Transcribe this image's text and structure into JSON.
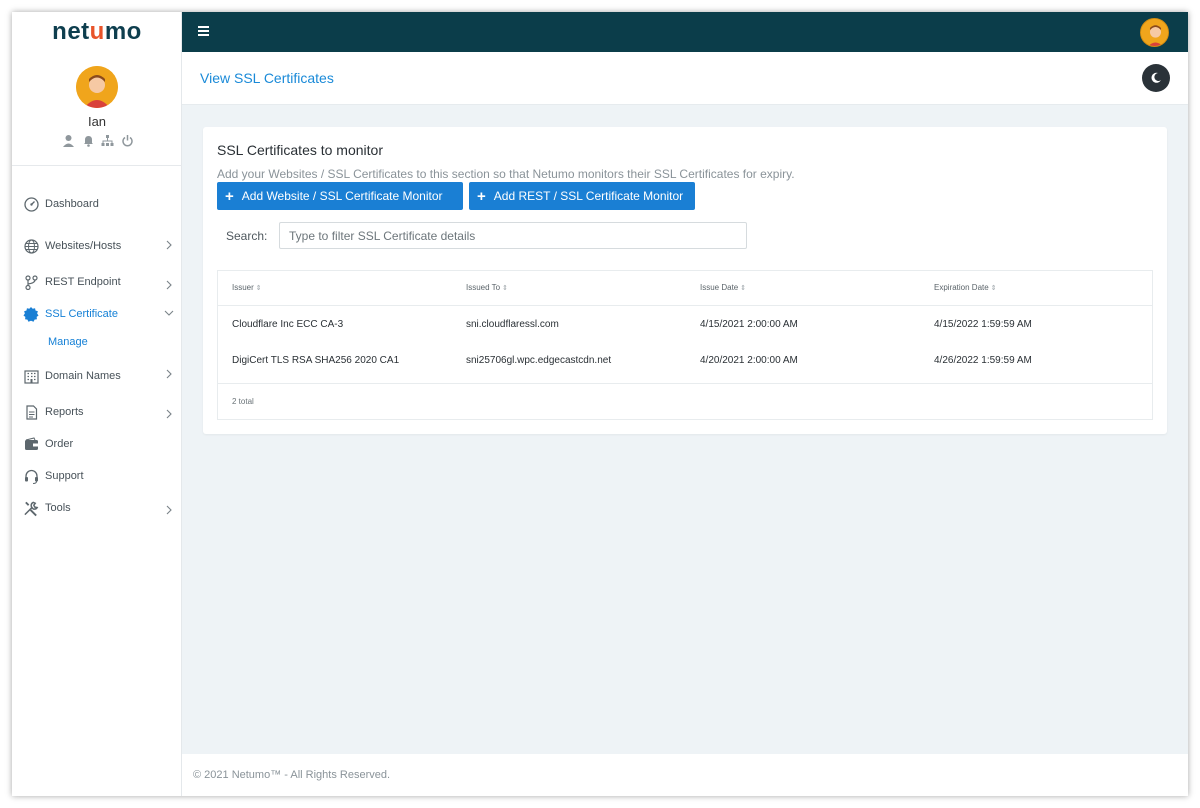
{
  "brand": {
    "logo_prefix": "net",
    "logo_accent": "u",
    "logo_suffix": "mo"
  },
  "user": {
    "name": "Ian"
  },
  "colors": {
    "accent": "#1a7fd4",
    "topbar": "#0b3d4a",
    "brand_accent": "#e8542a"
  },
  "sidebar": {
    "items": [
      {
        "label": "Dashboard",
        "icon": "dashboard-gauge-icon"
      },
      {
        "label": "Websites/Hosts",
        "icon": "globe-icon"
      },
      {
        "label": "REST Endpoint",
        "icon": "branch-icon"
      },
      {
        "label": "SSL Certificate",
        "icon": "ssl-badge-icon",
        "active": true
      },
      {
        "label": "Domain Names",
        "icon": "building-icon"
      },
      {
        "label": "Reports",
        "icon": "document-icon"
      },
      {
        "label": "Order",
        "icon": "wallet-icon"
      },
      {
        "label": "Support",
        "icon": "headset-icon"
      },
      {
        "label": "Tools",
        "icon": "tools-icon"
      }
    ],
    "submenu": {
      "label": "Manage"
    }
  },
  "header": {
    "title": "View SSL Certificates"
  },
  "card": {
    "title": "SSL Certificates to monitor",
    "description": "Add your Websites / SSL Certificates to this section so that Netumo monitors their SSL Certificates for expiry.",
    "btn_add_website": "Add Website / SSL Certificate Monitor",
    "btn_add_rest": "Add REST / SSL Certificate Monitor",
    "search_label": "Search:",
    "search_placeholder": "Type to filter SSL Certificate details"
  },
  "table": {
    "columns": [
      "Issuer",
      "Issued To",
      "Issue Date",
      "Expiration Date"
    ],
    "rows": [
      [
        "Cloudflare Inc ECC CA-3",
        "sni.cloudflaressl.com",
        "4/15/2021 2:00:00 AM",
        "4/15/2022 1:59:59 AM"
      ],
      [
        "DigiCert TLS RSA SHA256 2020 CA1",
        "sni25706gl.wpc.edgecastcdn.net",
        "4/20/2021 2:00:00 AM",
        "4/26/2022 1:59:59 AM"
      ]
    ],
    "total": "2 total"
  },
  "footer": {
    "text": "© 2021 Netumo™ - All Rights Reserved."
  }
}
